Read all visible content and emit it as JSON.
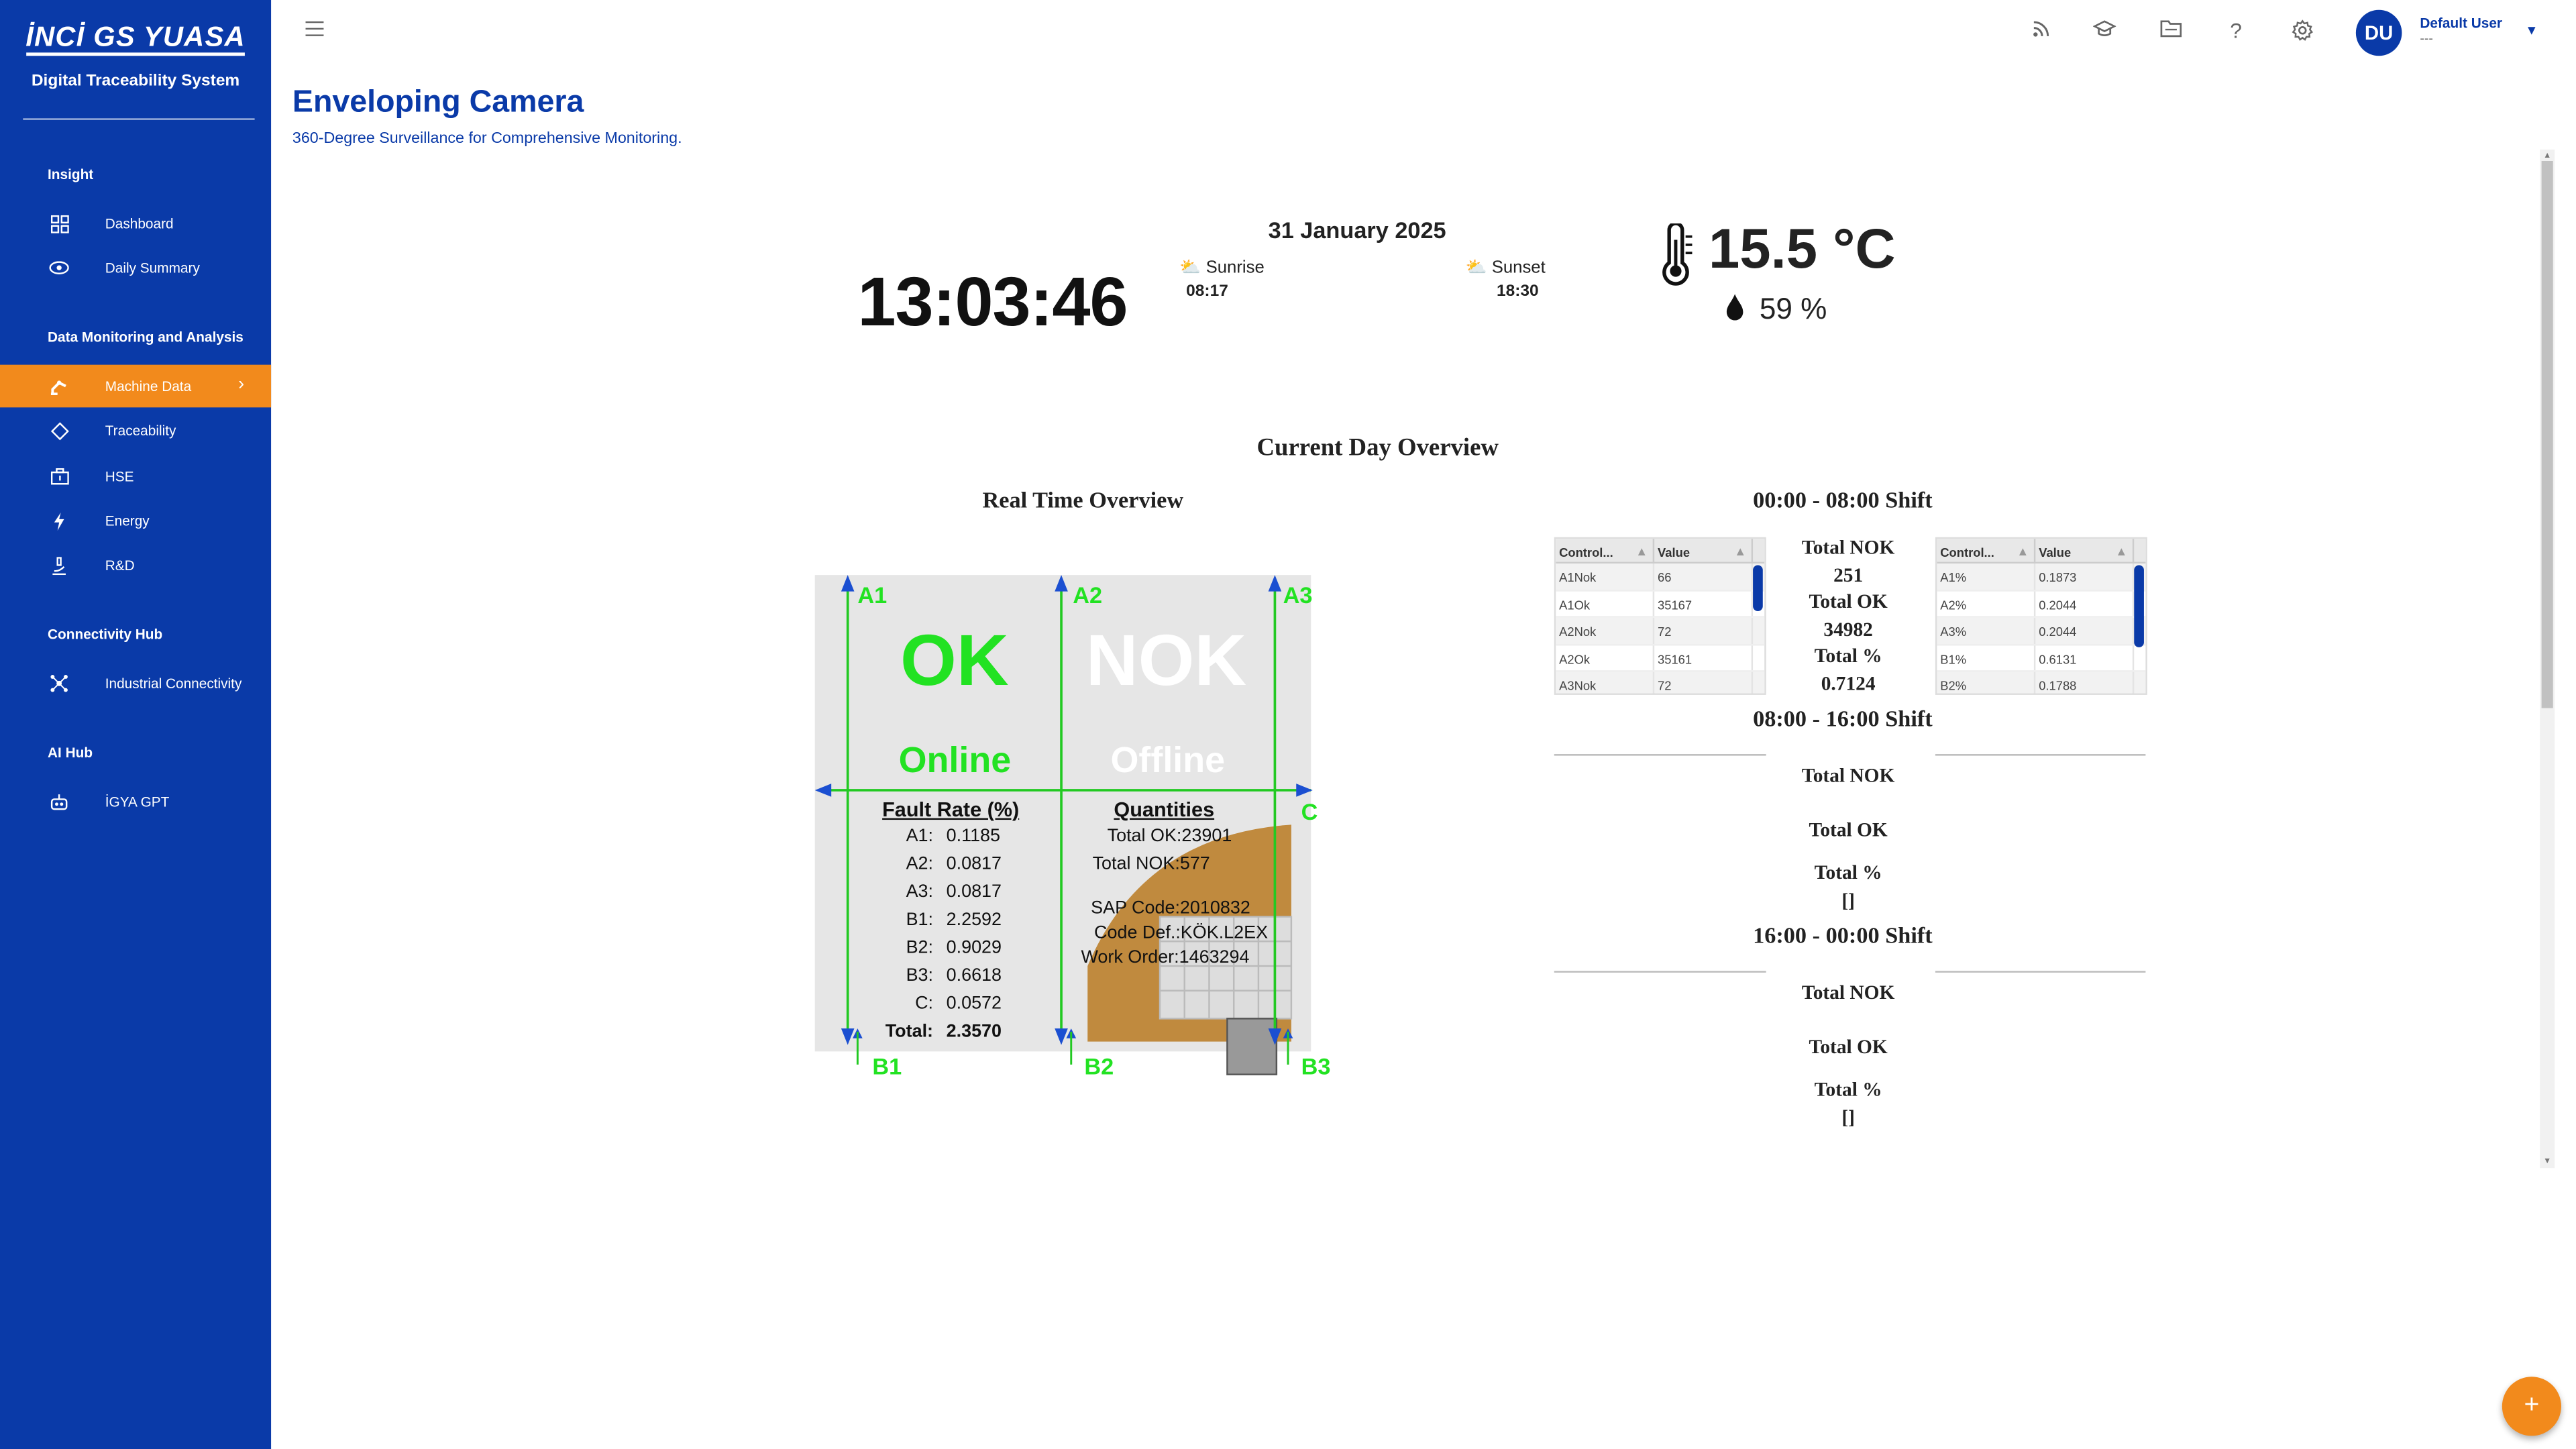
{
  "brand": {
    "logo": "İNCİ GS YUASA",
    "subtitle": "Digital Traceability System"
  },
  "sidebar": {
    "sections": [
      {
        "label": "Insight"
      },
      {
        "label": "Data Monitoring and Analysis"
      },
      {
        "label": "Connectivity Hub"
      },
      {
        "label": "AI Hub"
      }
    ],
    "items": [
      {
        "label": "Dashboard",
        "icon": "dashboard-icon"
      },
      {
        "label": "Daily Summary",
        "icon": "eye-icon"
      },
      {
        "label": "Machine Data",
        "icon": "robot-arm-icon",
        "active": true
      },
      {
        "label": "Traceability",
        "icon": "diamond-icon"
      },
      {
        "label": "HSE",
        "icon": "briefcase-icon"
      },
      {
        "label": "Energy",
        "icon": "lightning-icon"
      },
      {
        "label": "R&D",
        "icon": "microscope-icon"
      },
      {
        "label": "Industrial Connectivity",
        "icon": "network-icon"
      },
      {
        "label": "İGYA GPT",
        "icon": "robot-icon"
      }
    ]
  },
  "topbar": {
    "icons": [
      "rss-icon",
      "graduation-cap-icon",
      "folder-icon",
      "help-icon",
      "gear-icon"
    ],
    "user": {
      "initials": "DU",
      "name": "Default User",
      "role": "---"
    }
  },
  "page": {
    "title": "Enveloping Camera",
    "subtitle": "360-Degree Surveillance for Comprehensive Monitoring."
  },
  "clock": {
    "time": "13:03:46",
    "date": "31 January 2025",
    "sunrise_label": "Sunrise",
    "sunrise": "08:17",
    "sunset_label": "Sunset",
    "sunset": "18:30"
  },
  "weather": {
    "temperature": "15.5 °C",
    "humidity": "59 %"
  },
  "overview": {
    "title": "Current Day Overview",
    "realtime_title": "Real Time Overview"
  },
  "camera": {
    "status_left": "OK",
    "status_right": "NOK",
    "state_left": "Online",
    "state_right": "Offline",
    "points": {
      "A1": "A1",
      "A2": "A2",
      "A3": "A3",
      "B1": "B1",
      "B2": "B2",
      "B3": "B3",
      "C": "C"
    },
    "fault_title": "Fault Rate (%)",
    "faults": [
      {
        "k": "A1:",
        "v": "0.1185"
      },
      {
        "k": "A2:",
        "v": "0.0817"
      },
      {
        "k": "A3:",
        "v": "0.0817"
      },
      {
        "k": "B1:",
        "v": "2.2592"
      },
      {
        "k": "B2:",
        "v": "0.9029"
      },
      {
        "k": "B3:",
        "v": "0.6618"
      },
      {
        "k": "C:",
        "v": "0.0572"
      },
      {
        "k": "Total:",
        "v": "2.3570"
      }
    ],
    "quantities_title": "Quantities",
    "total_ok": "Total OK:23901",
    "total_nok": "Total NOK:577",
    "sap_code": "SAP Code:2010832",
    "code_def": "Code Def.:KÖK.L2EX",
    "work_order": "Work Order:1463294"
  },
  "shifts": [
    {
      "title": "00:00 - 08:00 Shift",
      "table1": {
        "headers": [
          "Control...",
          "Value"
        ],
        "rows": [
          [
            "A1Nok",
            "66"
          ],
          [
            "A1Ok",
            "35167"
          ],
          [
            "A2Nok",
            "72"
          ],
          [
            "A2Ok",
            "35161"
          ],
          [
            "A3Nok",
            "72"
          ]
        ]
      },
      "table2": {
        "headers": [
          "Control...",
          "Value"
        ],
        "rows": [
          [
            "A1%",
            "0.1873"
          ],
          [
            "A2%",
            "0.2044"
          ],
          [
            "A3%",
            "0.2044"
          ],
          [
            "B1%",
            "0.6131"
          ],
          [
            "B2%",
            "0.1788"
          ]
        ]
      },
      "total_nok_label": "Total NOK",
      "total_nok": "251",
      "total_ok_label": "Total OK",
      "total_ok": "34982",
      "total_pct_label": "Total %",
      "total_pct": "0.7124"
    },
    {
      "title": "08:00 - 16:00 Shift",
      "total_nok_label": "Total NOK",
      "total_ok_label": "Total OK",
      "total_pct_label": "Total %",
      "total_pct": "[]"
    },
    {
      "title": "16:00 - 00:00 Shift",
      "total_nok_label": "Total NOK",
      "total_ok_label": "Total OK",
      "total_pct_label": "Total %",
      "total_pct": "[]"
    }
  ],
  "fab": {
    "label": "+"
  }
}
